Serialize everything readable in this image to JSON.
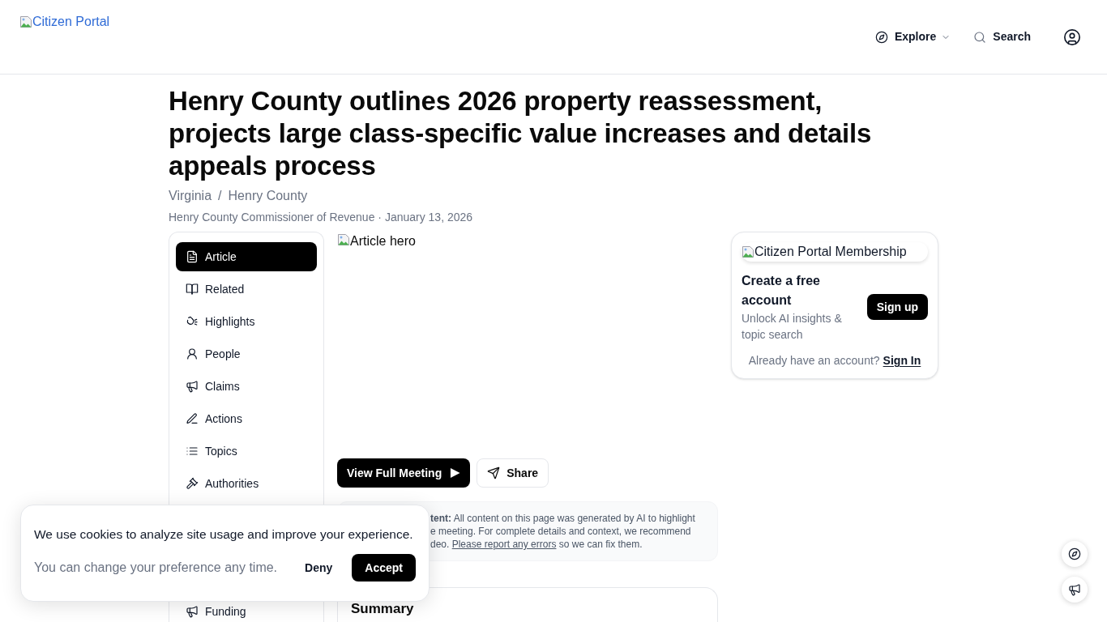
{
  "header": {
    "logo_alt": "Citizen Portal",
    "nav": [
      {
        "label": "Explore",
        "kind": "menu"
      },
      {
        "label": "Search",
        "kind": "search"
      }
    ]
  },
  "article": {
    "title": "Henry County outlines 2026 property reassessment, projects large class-specific value increases and details appeals process",
    "breadcrumb": {
      "items": [
        "Virginia",
        "Henry County"
      ],
      "separator": "/"
    },
    "byline": "Henry County Commissioner of Revenue · January 13, 2026"
  },
  "sidebar": {
    "items": [
      {
        "label": "Article",
        "selected": true
      },
      {
        "label": "Related",
        "selected": false
      },
      {
        "label": "Highlights",
        "selected": false
      },
      {
        "label": "People",
        "selected": false
      },
      {
        "label": "Claims",
        "selected": false
      },
      {
        "label": "Actions",
        "selected": false
      },
      {
        "label": "Topics",
        "selected": false
      },
      {
        "label": "Authorities",
        "selected": false
      }
    ],
    "items_below_banner": [
      {
        "label": "Funding",
        "selected": false
      }
    ]
  },
  "hero_image": {
    "alt": "Article hero"
  },
  "actions": [
    {
      "label": "View Full Meeting",
      "kind": "primary"
    },
    {
      "label": "Share",
      "kind": "secondary"
    }
  ],
  "disclaimer": {
    "lines": [
      "**tent:** All content on this page was generated by AI to highlight",
      "e meeting. For complete details and context, we recommend"
    ],
    "last_line": {
      "before": "deo. ",
      "link": "Please report any errors",
      "after": " so we can fix them."
    }
  },
  "summary": {
    "title": "Summary"
  },
  "membership": {
    "image_alt": "Citizen Portal Membership",
    "title": "Create a free account",
    "subtitle": "Unlock AI insights & topic search",
    "button": "Sign up",
    "signin_prompt": "Already have an account?",
    "signin_link": "Sign In"
  },
  "cookie_banner": {
    "message": "We use cookies to analyze site usage and improve your experience.",
    "note": "You can change your preference any time.",
    "buttons": [
      {
        "label": "Deny",
        "kind": "text"
      },
      {
        "label": "Accept",
        "kind": "primary"
      }
    ]
  }
}
